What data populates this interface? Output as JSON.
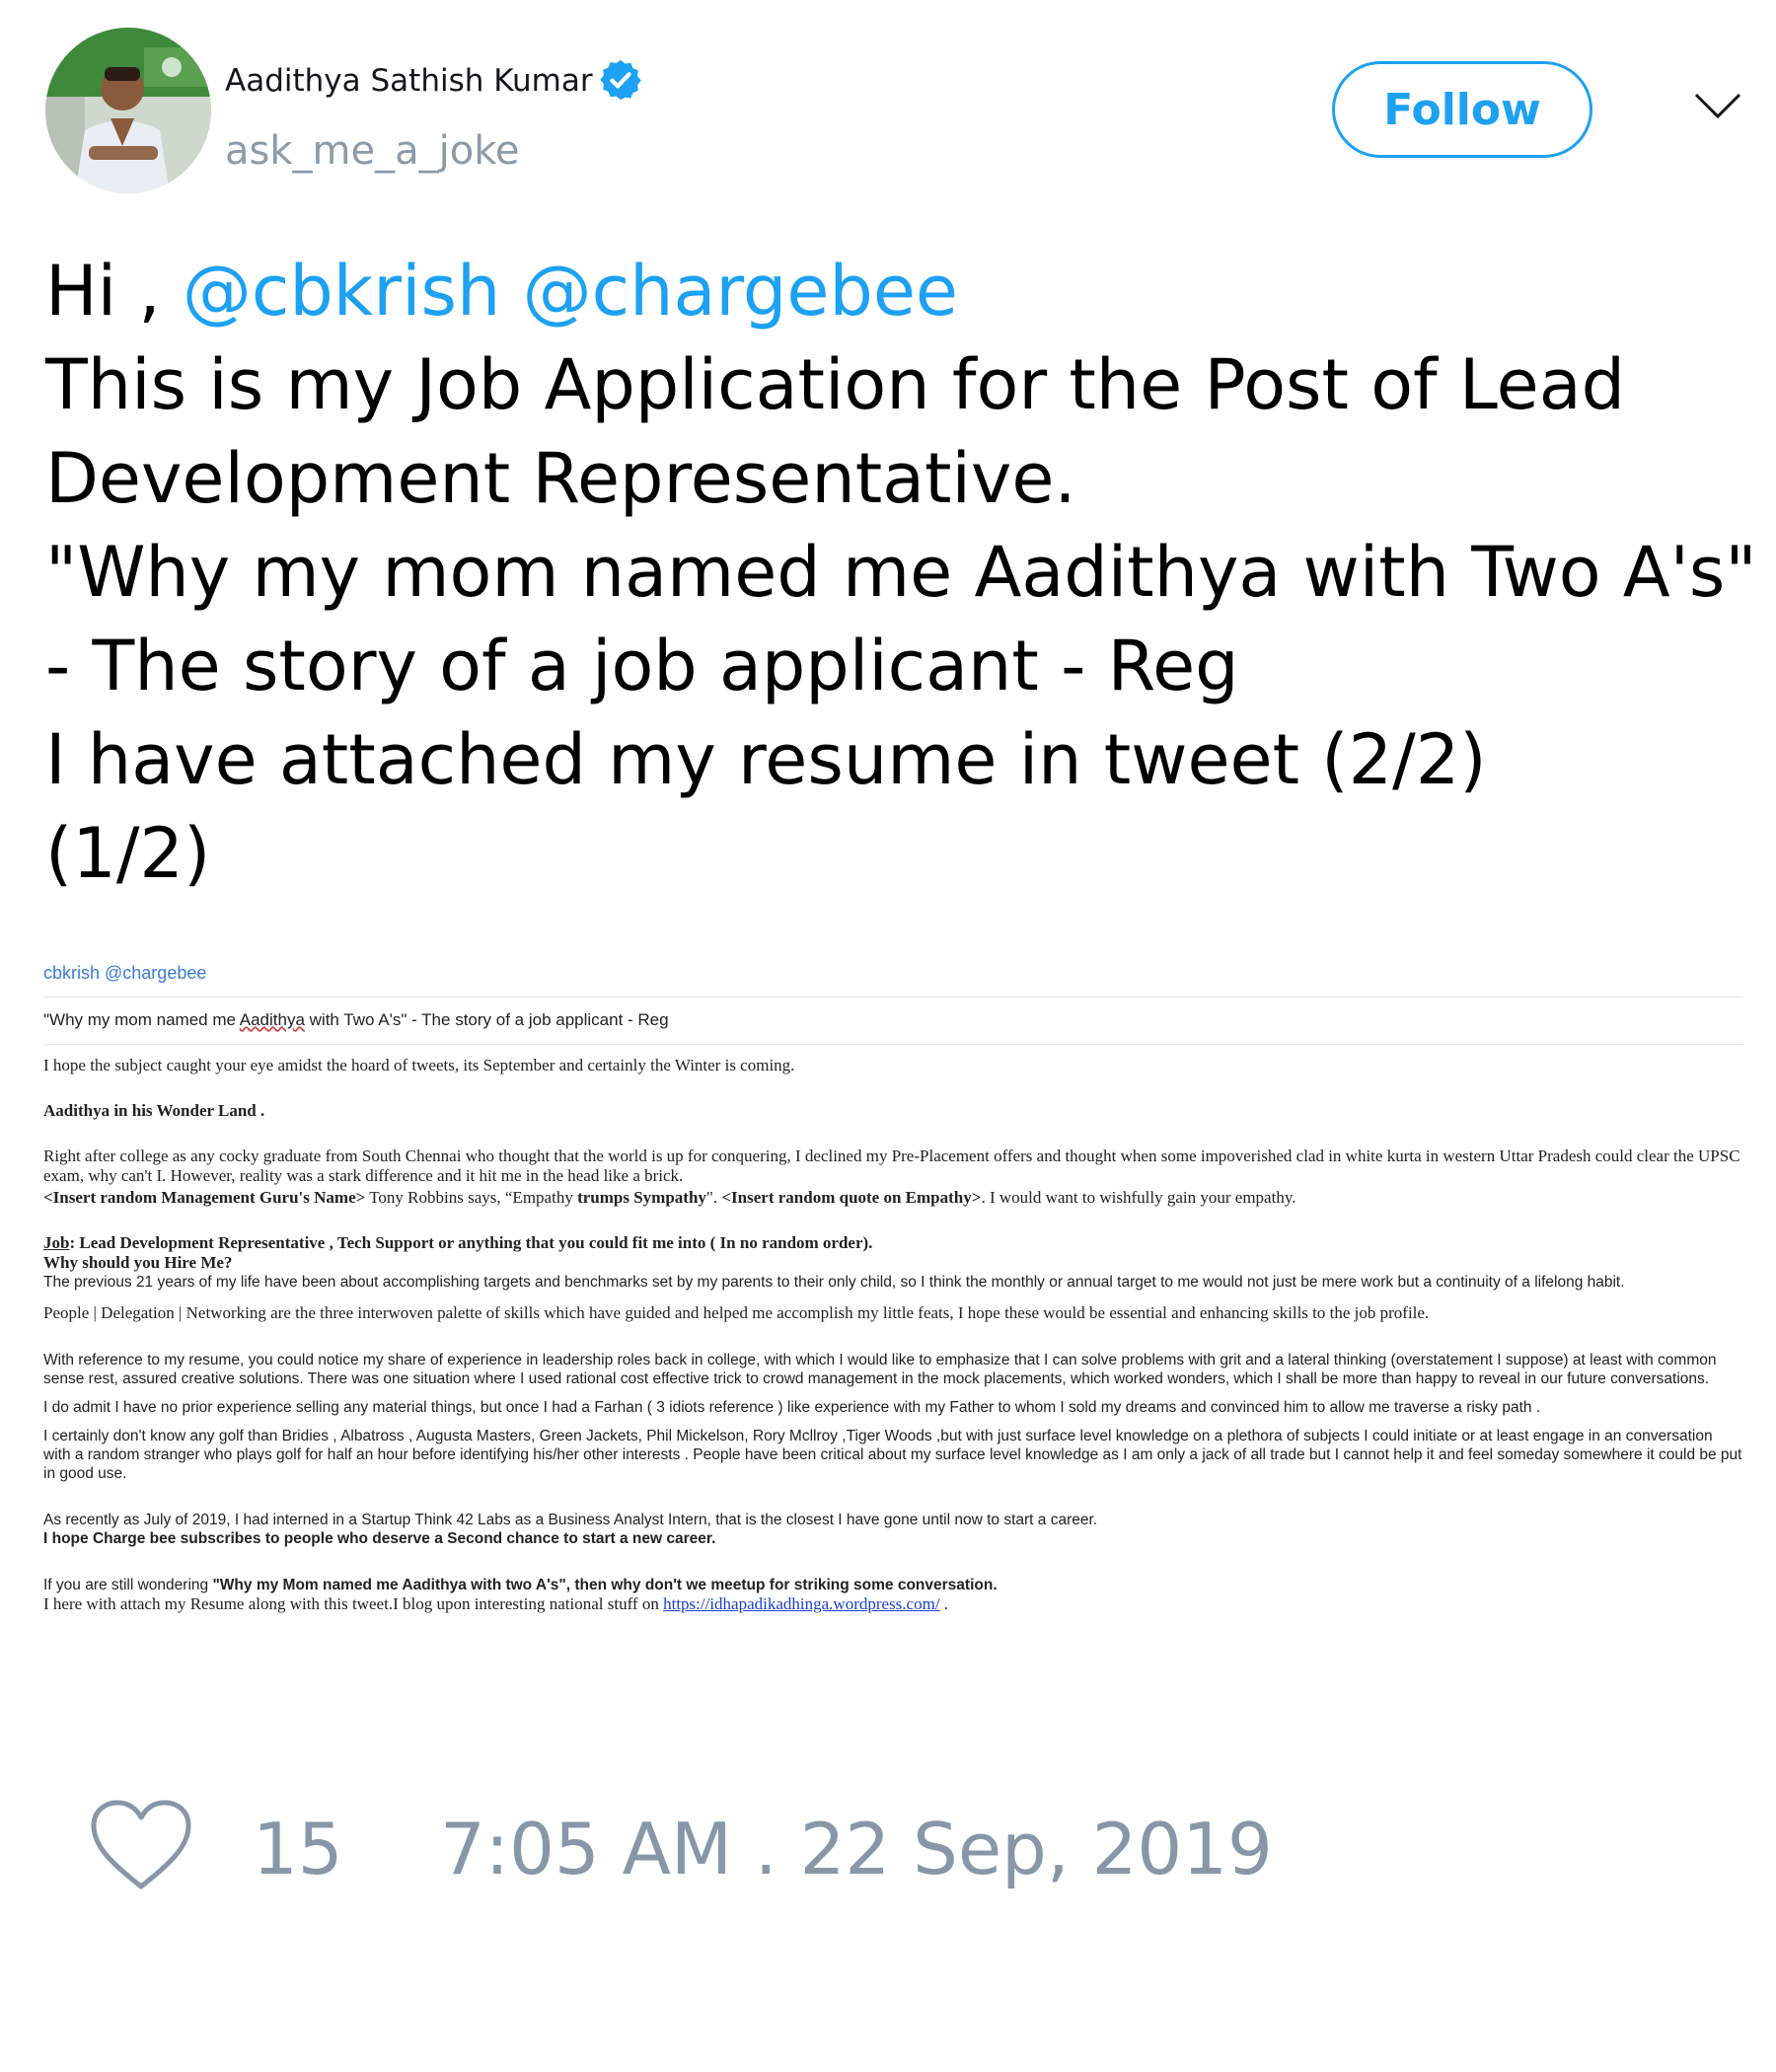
{
  "author": {
    "name": "Aadithya Sathish Kumar",
    "handle": "ask_me_a_joke",
    "verified": true,
    "avatar_icon": "profile-photo"
  },
  "follow_label": "Follow",
  "menu_icon": "chevron-down-icon",
  "tweet": {
    "greeting": "Hi , ",
    "mention_1": "@cbkrish",
    "mention_2": "@chargebee",
    "line_2": "This is my Job Application for the Post of Lead",
    "line_3": "Development Representative.",
    "line_4": "\"Why my mom named me Aadithya with Two A's\"",
    "line_5": "- The story of a job applicant - Reg",
    "line_6": "I have attached my resume in tweet (2/2)",
    "line_7": "(1/2)"
  },
  "attachment": {
    "to": "cbkrish @chargebee",
    "subject_a": "\"Why my mom named me ",
    "subject_misspelled": "Aadithya",
    "subject_b": " with Two A's\" - The story of a job applicant - Reg",
    "p1": "I hope the subject caught your eye amidst the hoard of tweets, its September and certainly the Winter is coming.",
    "h1": "Aadithya in his Wonder Land .",
    "p2a": "Right after college as any cocky graduate from South Chennai who thought that the world is up for conquering, I declined my Pre-Placement offers and thought when some impoverished clad in white kurta in western Uttar Pradesh  could clear the UPSC exam, why can't I. However, reality was a stark difference and it hit me in the head like a brick.",
    "p2b_bold1": "<Insert random Management Guru's Name>",
    "p2b_text1": " Tony Robbins says, “Empathy ",
    "p2b_bold2": "trumps Sympathy",
    "p2b_text2": "\". ",
    "p2b_bold3": "<Insert random quote on Empathy>",
    "p2b_text3": ".  I would want to wishfully gain your empathy.",
    "job_label": "Job",
    "job_text": ": Lead Development Representative , Tech Support or anything that you could fit me into ( In no random order).",
    "why_hire": "Why should you Hire Me?",
    "p3": "The previous 21 years of my life have been about accomplishing targets and benchmarks set by my parents to their only child, so I think the monthly or annual target to me would not just be mere work but a continuity of a lifelong habit.",
    "p4": "People | Delegation | Networking are the three interwoven palette of skills which have guided and helped me accomplish my little feats, I hope these would be essential and enhancing skills to the job profile.",
    "p5": "With reference to my resume, you could notice my share of experience in leadership roles back in college, with which I would like to emphasize that I can solve problems with grit and a lateral thinking (overstatement I suppose) at least with common sense rest, assured creative solutions. There was one situation where I used rational cost effective trick to crowd management in the mock placements, which worked wonders, which I shall be more than happy to reveal in our future conversations.",
    "p6": "I do admit I have no prior experience selling any material things, but once I had a Farhan ( 3 idiots reference ) like experience with my Father to whom I sold my dreams and convinced him to allow me traverse a risky path .",
    "p7": "I certainly don't know any golf than Bridies , Albatross , Augusta Masters, Green Jackets, Phil Mickelson, Rory Mcllroy ,Tiger Woods ,but with just surface level knowledge on a plethora of subjects I could initiate or at least engage in an conversation with a random stranger who plays golf for half an hour before identifying his/her other interests . People have been critical about my surface level knowledge as I am only a jack of all trade but I cannot help it and feel someday somewhere it could be put in good use.",
    "p8": "As recently as July of 2019, I had interned in a Startup Think 42 Labs as a Business Analyst Intern, that is the closest I have gone until now to start a career.",
    "p8b": " I hope Charge bee subscribes to  people who deserve a Second chance to start a new career.",
    "p9a": "If you are still wondering ",
    "p9b": "\"Why my Mom named me Aadithya with two A's\", then why don't we meetup for striking some conversation.",
    "p10": "I here with attach my Resume along with this tweet.I blog upon interesting national stuff on  ",
    "p10_link": "https://idhapadikadhinga.wordpress.com/",
    "p10_end": " ."
  },
  "likes": "15",
  "timestamp": "7:05 AM . 22 Sep, 2019",
  "colors": {
    "accent": "#1da1f2",
    "muted": "#8797a8"
  }
}
